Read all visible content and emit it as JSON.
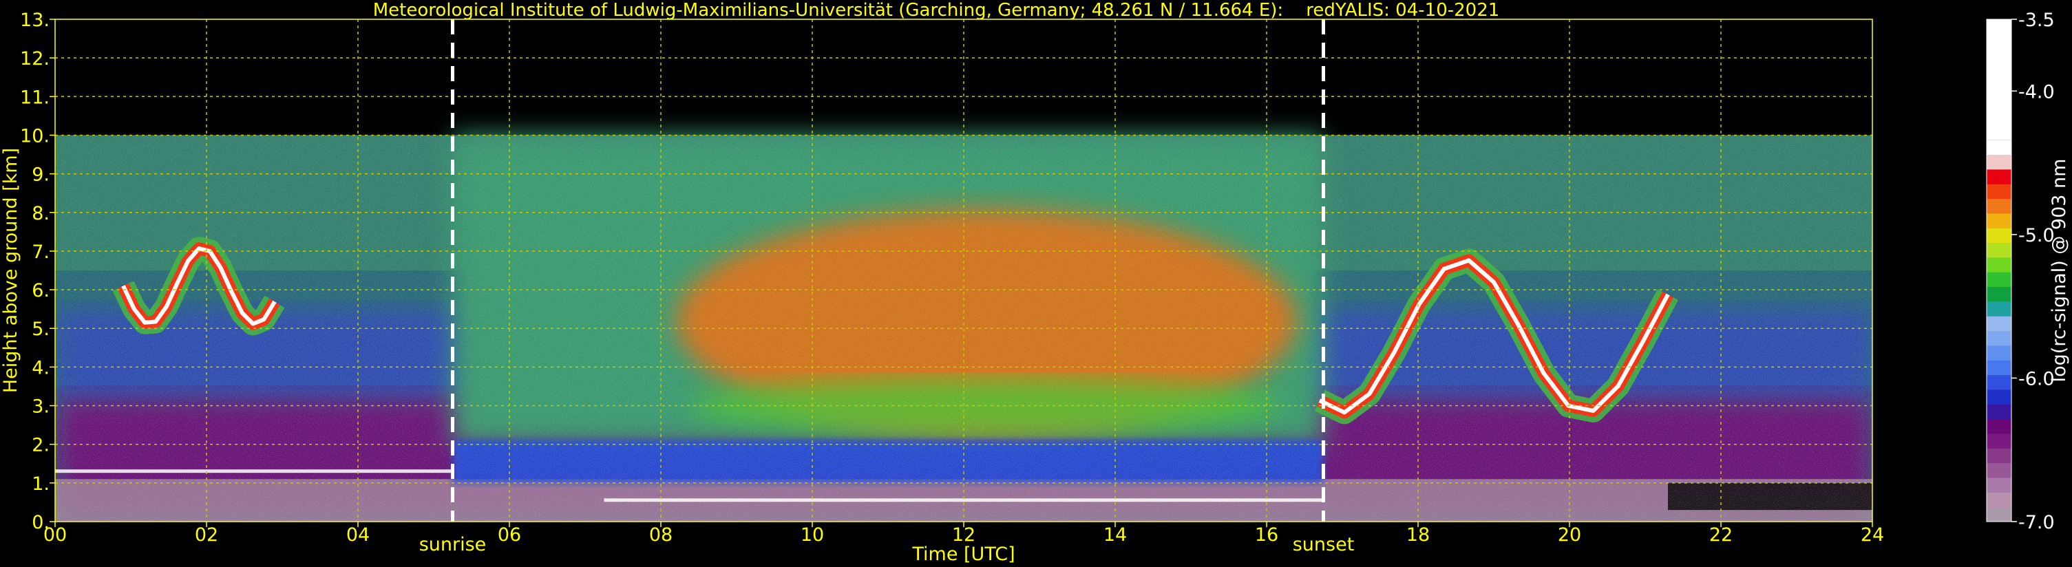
{
  "chart_data": {
    "type": "heatmap",
    "title": "Meteorological Institute of Ludwig-Maximilians-Universität (Garching, Germany; 48.261 N / 11.664 E):    redYALIS: 04-10-2021",
    "xlabel": "Time [UTC]",
    "ylabel": "Height above ground [km]",
    "xlim": [
      0,
      24
    ],
    "ylim": [
      0,
      13
    ],
    "x_ticks": [
      "00",
      "02",
      "04",
      "06",
      "08",
      "10",
      "12",
      "14",
      "16",
      "18",
      "20",
      "22",
      "24"
    ],
    "y_ticks": [
      "0.",
      "1.",
      "2.",
      "3.",
      "4.",
      "5.",
      "6.",
      "7.",
      "8.",
      "9.",
      "10.",
      "11.",
      "12.",
      "13."
    ],
    "grid": true,
    "grid_color": "#c8c800",
    "data_top_km": 10,
    "annotations": [
      {
        "label": "sunrise",
        "x": 5.25
      },
      {
        "label": "sunset",
        "x": 16.75
      }
    ],
    "colorbar": {
      "label": "log(rc-signal) @ 903 nm",
      "range": [
        -7.0,
        -3.5
      ],
      "ticks": [
        "-3.5",
        "-4.0",
        "-5.0",
        "-6.0",
        "-7.0"
      ],
      "tick_values": [
        -3.5,
        -4.0,
        -5.0,
        -6.0,
        -7.0
      ],
      "colors": [
        "#a898a8",
        "#b890b0",
        "#a878a8",
        "#985898",
        "#883888",
        "#7a1a80",
        "#6a0878",
        "#3818a0",
        "#2030c8",
        "#3050e0",
        "#4878ee",
        "#6090f0",
        "#80a8f0",
        "#98b8f0",
        "#20a0a0",
        "#10a040",
        "#30c030",
        "#70d820",
        "#b0e020",
        "#e0e010",
        "#f0b010",
        "#f07818",
        "#f04010",
        "#e80010",
        "#f0c8c8",
        "#ffffff"
      ]
    },
    "features": [
      {
        "name": "cloud",
        "x": [
          0.9,
          2.9
        ],
        "y_km": [
          5.0,
          7.2
        ]
      },
      {
        "name": "cloud",
        "x": [
          16.7,
          21.3
        ],
        "y_km": [
          2.6,
          7.0
        ]
      },
      {
        "name": "aerosol layer",
        "x": [
          0,
          24
        ],
        "y_km": [
          0,
          1.5
        ]
      }
    ]
  },
  "colors": {
    "background": "#000000",
    "text": "#ffff00",
    "marker_lines": "#ffffff"
  }
}
